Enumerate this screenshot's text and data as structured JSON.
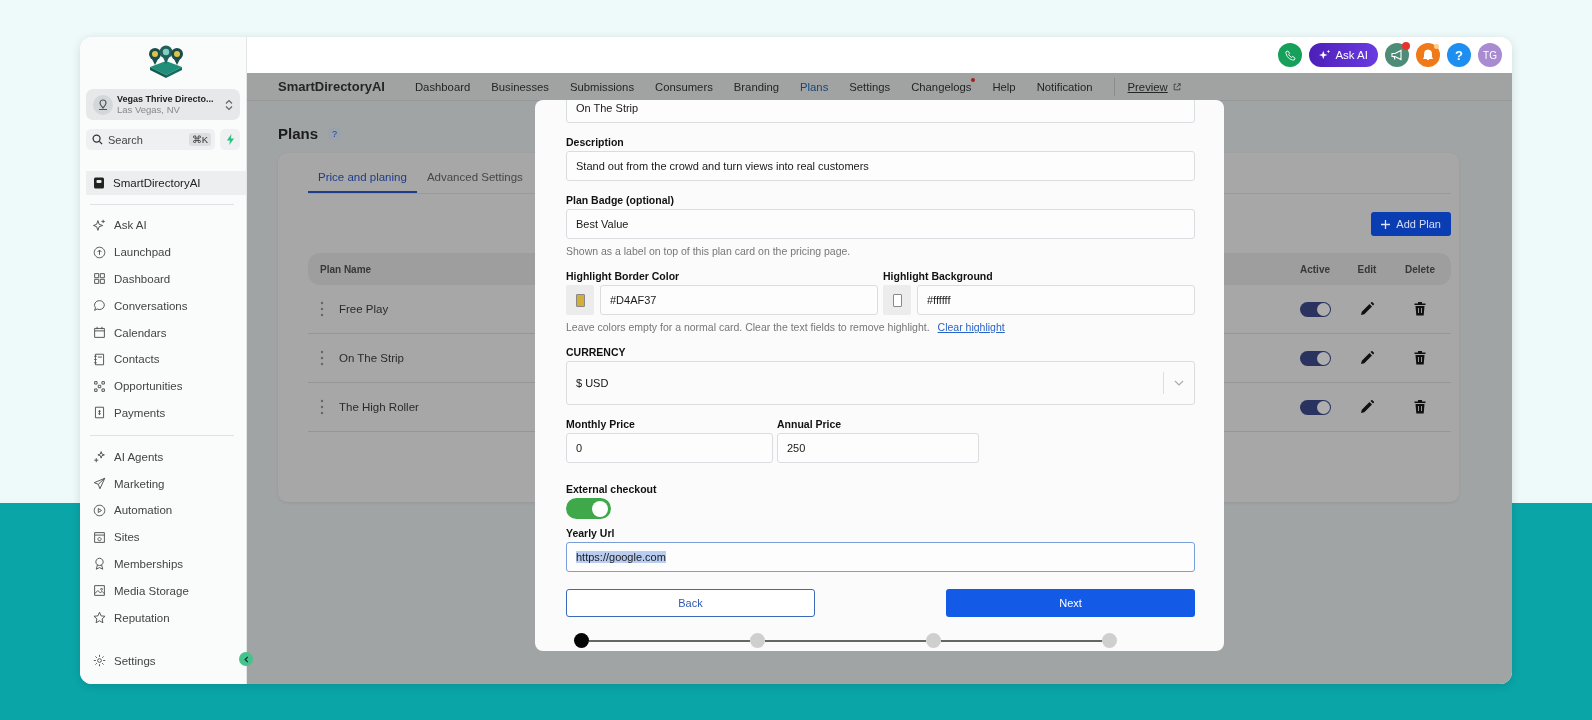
{
  "sidebar": {
    "location": {
      "name": "Vegas Thrive Directo...",
      "city": "Las Vegas, NV"
    },
    "search": {
      "placeholder": "Search",
      "shortcut": "⌘K"
    },
    "pinned": {
      "label": "SmartDirectoryAI",
      "selected": true
    },
    "main_items": [
      {
        "label": "Ask AI",
        "selected": false
      },
      {
        "label": "Launchpad",
        "selected": false
      },
      {
        "label": "Dashboard",
        "selected": false
      },
      {
        "label": "Conversations",
        "selected": false
      },
      {
        "label": "Calendars",
        "selected": false
      },
      {
        "label": "Contacts",
        "selected": false
      },
      {
        "label": "Opportunities",
        "selected": false
      },
      {
        "label": "Payments",
        "selected": false
      }
    ],
    "tool_items": [
      {
        "label": "AI Agents",
        "selected": false
      },
      {
        "label": "Marketing",
        "selected": false
      },
      {
        "label": "Automation",
        "selected": false
      },
      {
        "label": "Sites",
        "selected": false
      },
      {
        "label": "Memberships",
        "selected": false
      },
      {
        "label": "Media Storage",
        "selected": false
      },
      {
        "label": "Reputation",
        "selected": false
      }
    ],
    "settings": "Settings"
  },
  "header": {
    "ask_ai": "Ask AI",
    "announcements_unread": true,
    "alerts_unread": true,
    "help": "?",
    "avatar": "TG"
  },
  "nav": {
    "brand": "SmartDirectoryAI",
    "items": [
      {
        "label": "Dashboard",
        "selected": false,
        "dot": false
      },
      {
        "label": "Businesses",
        "selected": false,
        "dot": false
      },
      {
        "label": "Submissions",
        "selected": false,
        "dot": false
      },
      {
        "label": "Consumers",
        "selected": false,
        "dot": false
      },
      {
        "label": "Branding",
        "selected": false,
        "dot": false
      },
      {
        "label": "Plans",
        "selected": true,
        "dot": false
      },
      {
        "label": "Settings",
        "selected": false,
        "dot": false
      },
      {
        "label": "Changelogs",
        "selected": false,
        "dot": true
      },
      {
        "label": "Help",
        "selected": false,
        "dot": false
      },
      {
        "label": "Notification",
        "selected": false,
        "dot": false
      }
    ],
    "preview": "Preview"
  },
  "page": {
    "title": "Plans",
    "help": "?",
    "tabs": [
      {
        "label": "Price and planing",
        "selected": true
      },
      {
        "label": "Advanced Settings",
        "selected": false
      }
    ],
    "add_button": "Add Plan",
    "table": {
      "columns": [
        "Plan Name",
        "Active",
        "Edit",
        "Delete"
      ],
      "rows": [
        {
          "name": "Free Play",
          "active": true
        },
        {
          "name": "On The Strip",
          "active": true
        },
        {
          "name": "The High Roller",
          "active": true
        }
      ]
    }
  },
  "modal": {
    "plan_name": {
      "value": "On The Strip"
    },
    "description": {
      "label": "Description",
      "value": "Stand out from the crowd and turn views into real customers"
    },
    "badge": {
      "label": "Plan Badge (optional)",
      "value": "Best Value",
      "hint": "Shown as a label on top of this plan card on the pricing page."
    },
    "highlight_border": {
      "label": "Highlight Border Color",
      "value": "#D4AF37"
    },
    "highlight_background": {
      "label": "Highlight Background",
      "value": "#ffffff"
    },
    "colors_hint": "Leave colors empty for a normal card. Clear the text fields to remove highlight.",
    "clear_link": "Clear highlight",
    "currency": {
      "label": "CURRENCY",
      "value": "$ USD"
    },
    "monthly_price": {
      "label": "Monthly Price",
      "value": "0"
    },
    "annual_price": {
      "label": "Annual Price",
      "value": "250"
    },
    "external_checkout": {
      "label": "External checkout",
      "on": true
    },
    "yearly_url": {
      "label": "Yearly Url",
      "value": "https://google.com",
      "text_selected": true
    },
    "back": "Back",
    "next": "Next",
    "steps": [
      {
        "selected": true
      },
      {
        "selected": false
      },
      {
        "selected": false
      },
      {
        "selected": false
      }
    ]
  }
}
